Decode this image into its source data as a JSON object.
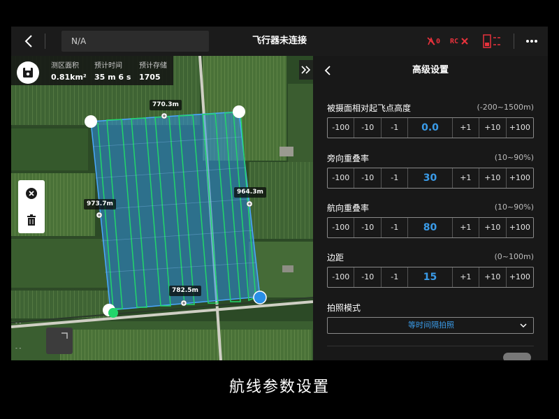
{
  "topbar": {
    "mission_name": "N/A",
    "connection_status": "飞行器未连接",
    "rc_signal": "0",
    "rc_label": "RC",
    "rc_status_icon": "close-icon",
    "icons": [
      "back-arrow-icon",
      "antenna-signal-icon",
      "battery-icon",
      "more-icon"
    ]
  },
  "stats": {
    "area": {
      "label": "测区面积",
      "value": "0.81km²"
    },
    "time": {
      "label": "预计时间",
      "value": "35 m 6 s"
    },
    "storage": {
      "label": "预计存储",
      "value": "1705"
    }
  },
  "map": {
    "edges": {
      "top": "770.3m",
      "left": "973.7m",
      "right": "964.3m",
      "bottom": "782.5m"
    },
    "scale_text": "- -",
    "tools": [
      "close-circle-icon",
      "trash-icon"
    ],
    "colors": {
      "polygon_fill": "#2f8fe0",
      "route": "#22d66a",
      "vertex": "#ffffff",
      "start_point": "#2a8fe6"
    }
  },
  "panel": {
    "title": "高级设置",
    "steps": {
      "m100": "-100",
      "m10": "-10",
      "m1": "-1",
      "p1": "+1",
      "p10": "+10",
      "p100": "+100"
    },
    "settings": [
      {
        "name": "被摄面相对起飞点高度",
        "range": "(-200~1500m)",
        "value": "0.0"
      },
      {
        "name": "旁向重叠率",
        "range": "(10~90%)",
        "value": "30"
      },
      {
        "name": "航向重叠率",
        "range": "(10~90%)",
        "value": "80"
      },
      {
        "name": "边距",
        "range": "(0~100m)",
        "value": "15"
      }
    ],
    "photo_mode": {
      "name": "拍照模式",
      "value": "等时间隔拍照"
    },
    "accent_color": "#3a9be8"
  },
  "caption": "航线参数设置"
}
